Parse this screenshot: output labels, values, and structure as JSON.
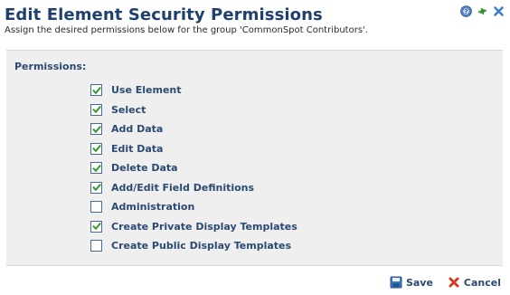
{
  "header": {
    "title": "Edit Element Security Permissions",
    "subtitle": "Assign the desired permissions below for the group 'CommonSpot Contributors'."
  },
  "top_icons": [
    "help-icon",
    "refresh-icon",
    "close-icon"
  ],
  "permissions": {
    "label": "Permissions:",
    "items": [
      {
        "label": "Use Element",
        "checked": true
      },
      {
        "label": "Select",
        "checked": true
      },
      {
        "label": "Add Data",
        "checked": true
      },
      {
        "label": "Edit Data",
        "checked": true
      },
      {
        "label": "Delete Data",
        "checked": true
      },
      {
        "label": "Add/Edit Field Definitions",
        "checked": true
      },
      {
        "label": "Administration",
        "checked": false
      },
      {
        "label": "Create Private Display Templates",
        "checked": true
      },
      {
        "label": "Create Public Display Templates",
        "checked": false
      }
    ]
  },
  "footer": {
    "save_label": "Save",
    "cancel_label": "Cancel"
  },
  "colors": {
    "title": "#1f3f6e",
    "text": "#2a4a72",
    "panel_bg": "#efefef",
    "check": "#2e9a2e",
    "cancel_x": "#d83a2a",
    "save_icon": "#3a78c2"
  }
}
